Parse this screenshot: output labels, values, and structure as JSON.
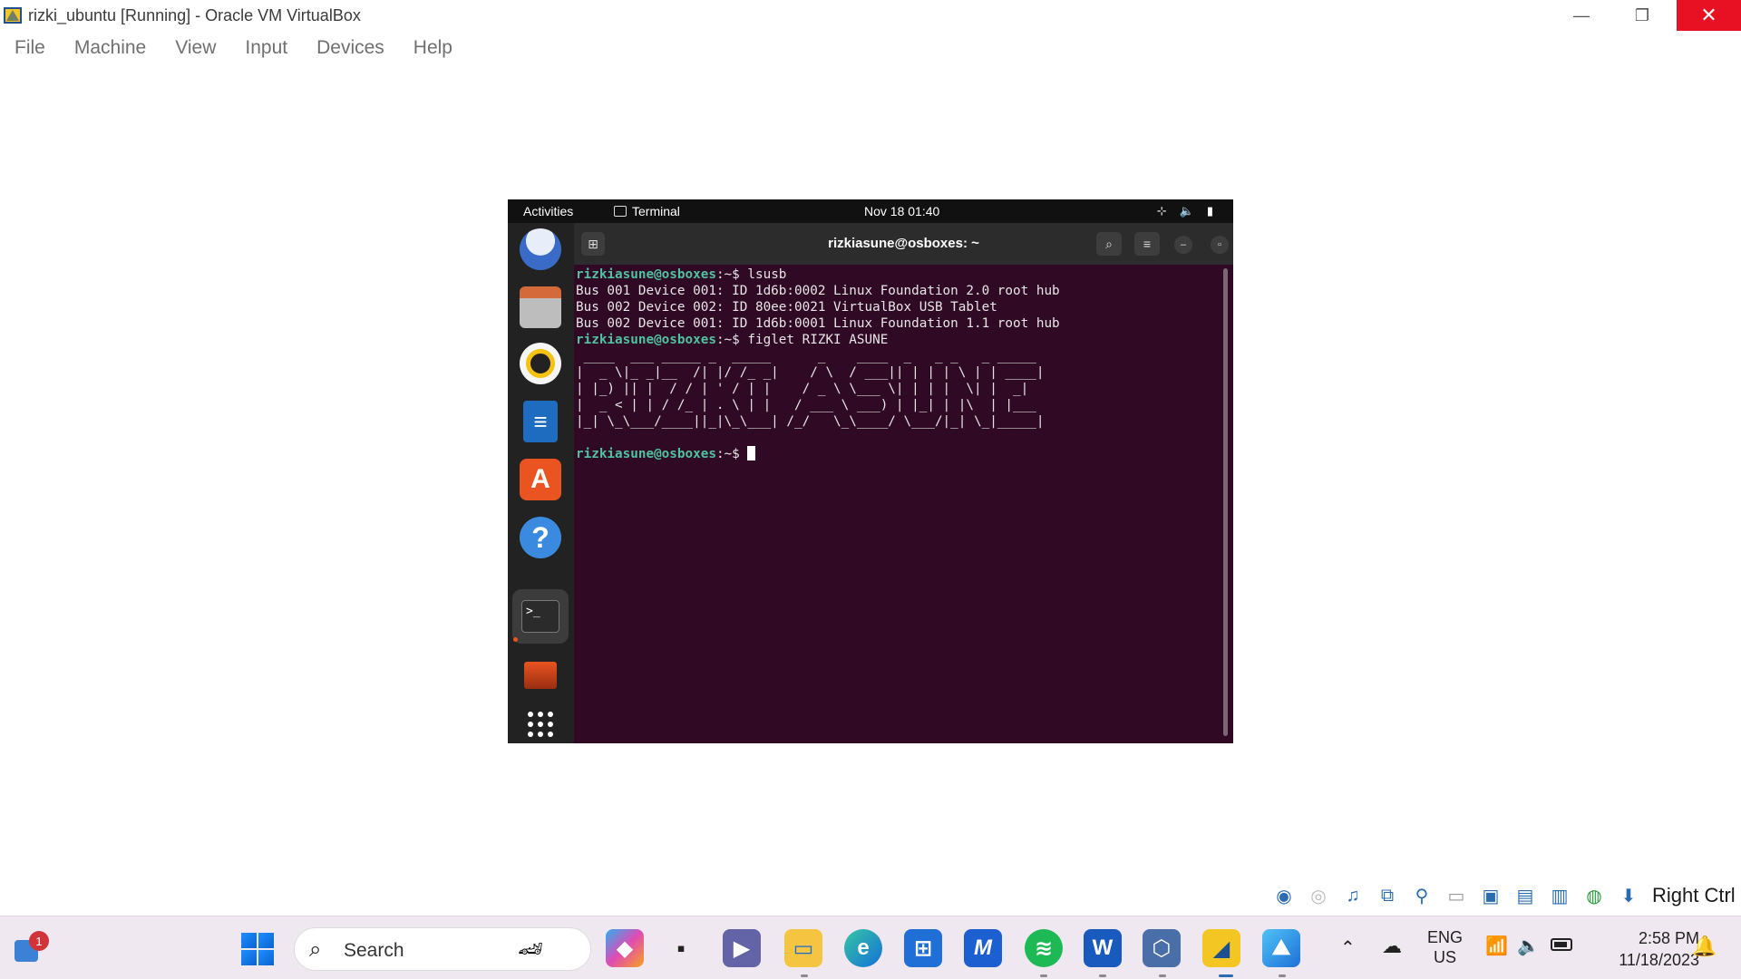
{
  "window": {
    "title": "rizki_ubuntu [Running] - Oracle VM VirtualBox",
    "minimize_glyph": "—",
    "maximize_glyph": "❐",
    "close_glyph": "✕"
  },
  "menubar": {
    "items": [
      "File",
      "Machine",
      "View",
      "Input",
      "Devices",
      "Help"
    ]
  },
  "guest": {
    "topbar": {
      "activities": "Activities",
      "app_name": "Terminal",
      "clock": "Nov 18  01:40"
    },
    "terminal": {
      "title": "rizkiasune@osboxes: ~",
      "prompt_user": "rizkiasune@osboxes",
      "prompt_suffix": ":~$ ",
      "lines": [
        {
          "type": "prompt",
          "cmd": "lsusb"
        },
        {
          "type": "out",
          "text": "Bus 001 Device 001: ID 1d6b:0002 Linux Foundation 2.0 root hub"
        },
        {
          "type": "out",
          "text": "Bus 002 Device 002: ID 80ee:0021 VirtualBox USB Tablet"
        },
        {
          "type": "out",
          "text": "Bus 002 Device 001: ID 1d6b:0001 Linux Foundation 1.1 root hub"
        },
        {
          "type": "prompt",
          "cmd": "figlet RIZKI ASUNE"
        },
        {
          "type": "out",
          "text": " ____  ___ _____ _  _____      _    ____  _   _ _   _ _____ "
        },
        {
          "type": "out",
          "text": "|  _ \\|_ _|__  /| |/ /_ _|    / \\  / ___|| | | | \\ | | ____|"
        },
        {
          "type": "out",
          "text": "| |_) || |  / / | ' / | |    / _ \\ \\___ \\| | | |  \\| |  _|  "
        },
        {
          "type": "out",
          "text": "|  _ < | | / /_ | . \\ | |   / ___ \\ ___) | |_| | |\\  | |___ "
        },
        {
          "type": "out",
          "text": "|_| \\_\\___/____||_|\\_\\___| /_/   \\_\\____/ \\___/|_| \\_|_____|"
        },
        {
          "type": "out",
          "text": ""
        },
        {
          "type": "prompt",
          "cmd": "",
          "cursor": true
        }
      ]
    }
  },
  "statusbar": {
    "host_key": "Right Ctrl"
  },
  "taskbar": {
    "widgets_badge": "1",
    "search_placeholder": "Search",
    "language": "ENG",
    "region": "US",
    "time": "2:58 PM",
    "date": "11/18/2023"
  }
}
